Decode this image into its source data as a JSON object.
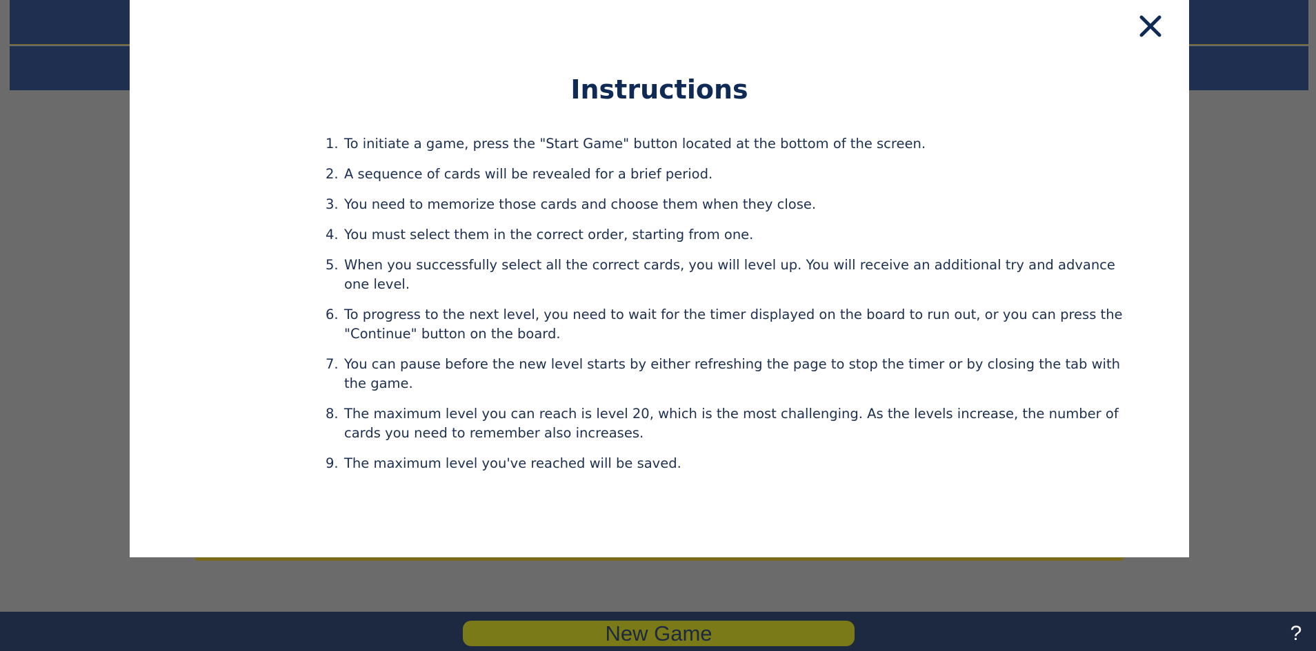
{
  "bottom_bar": {
    "new_game_label": "New Game",
    "help_label": "?"
  },
  "modal": {
    "title": "Instructions",
    "close_icon": "close-icon",
    "items": [
      {
        "num": "1.",
        "text": "To initiate a game, press the \"Start Game\" button located at the bottom of the screen."
      },
      {
        "num": "2.",
        "text": "A sequence of cards will be revealed for a brief period."
      },
      {
        "num": "3.",
        "text": "You need to memorize those cards and choose them when they close."
      },
      {
        "num": "4.",
        "text": "You must select them in the correct order, starting from one."
      },
      {
        "num": "5.",
        "text": "When you successfully select all the correct cards, you will level up. You will receive an additional try and advance one level."
      },
      {
        "num": "6.",
        "text": "To progress to the next level, you need to wait for the timer displayed on the board to run out, or you can press the \"Continue\" button on the board."
      },
      {
        "num": "7.",
        "text": "You can pause before the new level starts by either refreshing the page to stop the timer or by closing the tab with the game."
      },
      {
        "num": "8.",
        "text": "The maximum level you can reach is level 20, which is the most challenging. As the levels increase, the number of cards you need to remember also increases."
      },
      {
        "num": "9.",
        "text": "The maximum level you've reached will be saved."
      }
    ]
  },
  "colors": {
    "navy": "#1c2940",
    "title_navy": "#0e2a55",
    "button_olive": "#7a7a18",
    "overlay_gray": "#6b6b6b"
  }
}
